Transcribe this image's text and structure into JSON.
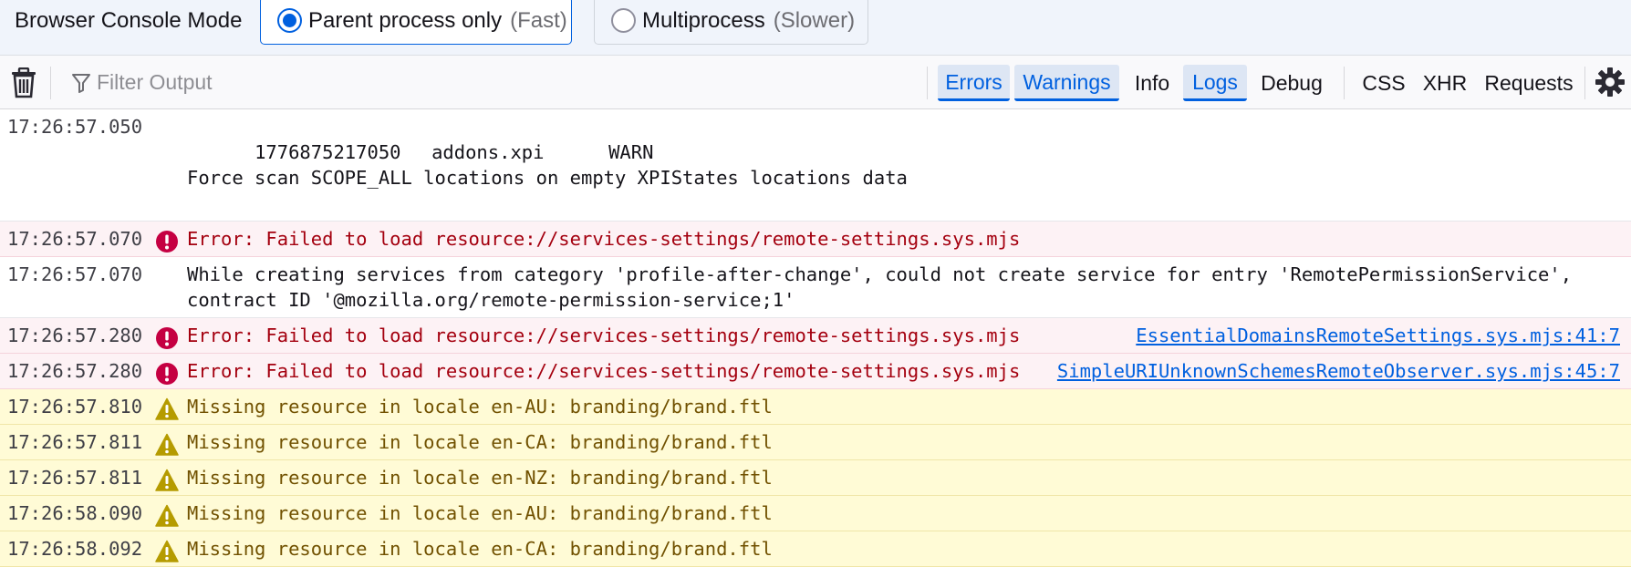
{
  "mode_bar": {
    "label": "Browser Console Mode",
    "options": [
      {
        "label": "Parent process only",
        "hint": "(Fast)",
        "selected": true
      },
      {
        "label": "Multiprocess",
        "hint": "(Slower)",
        "selected": false
      }
    ]
  },
  "toolbar": {
    "clear_icon": "trash-icon",
    "filter_placeholder": "Filter Output",
    "filters": [
      {
        "label": "Errors",
        "active": true
      },
      {
        "label": "Warnings",
        "active": true
      },
      {
        "label": "Info",
        "active": false
      },
      {
        "label": "Logs",
        "active": true
      },
      {
        "label": "Debug",
        "active": false
      }
    ],
    "network_filters": [
      {
        "label": "CSS",
        "active": false
      },
      {
        "label": "XHR",
        "active": false
      },
      {
        "label": "Requests",
        "active": false
      }
    ],
    "settings_icon": "gear-icon"
  },
  "colors": {
    "accent": "#0060df",
    "error_bg": "#fdf2f5",
    "error_text": "#a4000f",
    "warning_bg": "#fffbd6",
    "warning_text": "#715100"
  },
  "messages": [
    {
      "level": "log",
      "time": "17:26:57.050",
      "cols": [
        "1776875217050",
        "addons.xpi",
        "WARN",
        "Force scan SCOPE_ALL locations on empty XPIStates locations data"
      ]
    },
    {
      "level": "error",
      "time": "17:26:57.070",
      "text": "Error: Failed to load resource://services-settings/remote-settings.sys.mjs",
      "source": ""
    },
    {
      "level": "log",
      "time": "17:26:57.070",
      "text": "While creating services from category 'profile-after-change', could not create service for entry 'RemotePermissionService', contract ID '@mozilla.org/remote-permission-service;1'"
    },
    {
      "level": "error",
      "time": "17:26:57.280",
      "text": "Error: Failed to load resource://services-settings/remote-settings.sys.mjs",
      "source": "EssentialDomainsRemoteSettings.sys.mjs:41:7"
    },
    {
      "level": "error",
      "time": "17:26:57.280",
      "text": "Error: Failed to load resource://services-settings/remote-settings.sys.mjs",
      "source": "SimpleURIUnknownSchemesRemoteObserver.sys.mjs:45:7"
    },
    {
      "level": "warning",
      "time": "17:26:57.810",
      "text": "Missing resource in locale en-AU: branding/brand.ftl"
    },
    {
      "level": "warning",
      "time": "17:26:57.811",
      "text": "Missing resource in locale en-CA: branding/brand.ftl"
    },
    {
      "level": "warning",
      "time": "17:26:57.811",
      "text": "Missing resource in locale en-NZ: branding/brand.ftl"
    },
    {
      "level": "warning",
      "time": "17:26:58.090",
      "text": "Missing resource in locale en-AU: branding/brand.ftl"
    },
    {
      "level": "warning",
      "time": "17:26:58.092",
      "text": "Missing resource in locale en-CA: branding/brand.ftl"
    }
  ]
}
